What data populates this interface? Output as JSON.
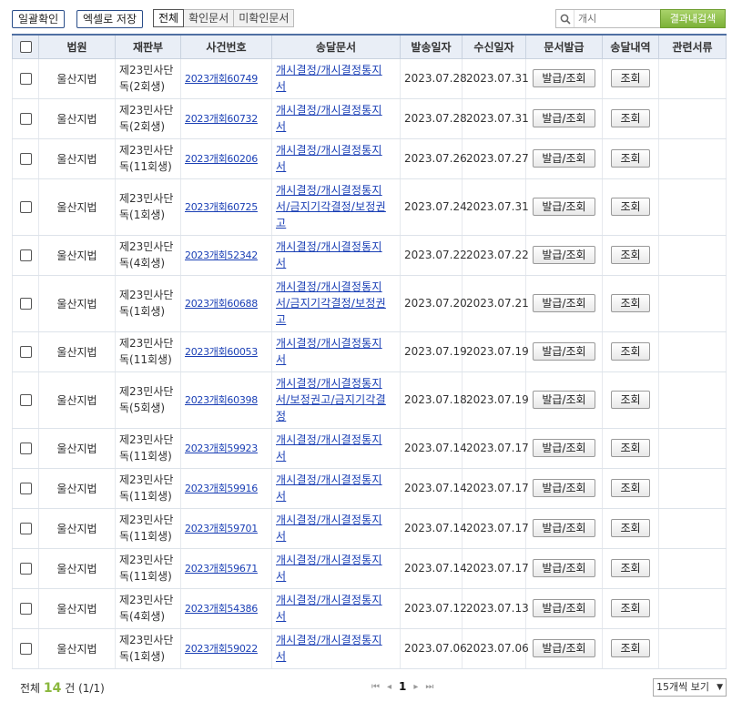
{
  "toolbar": {
    "bulk_confirm_label": "일괄확인",
    "excel_save_label": "엑셀로 저장",
    "tabs": [
      "전체",
      "확인문서",
      "미확인문서"
    ],
    "search_placeholder": "개시",
    "search_button_label": "결과내검색"
  },
  "table": {
    "headers": [
      "법원",
      "재판부",
      "사건번호",
      "송달문서",
      "발송일자",
      "수신일자",
      "문서발급",
      "송달내역",
      "관련서류"
    ],
    "issue_button_label": "발급/조회",
    "view_button_label": "조회",
    "rows": [
      {
        "court": "울산지법",
        "division_1": "제23민사단",
        "division_2": "독(2회생)",
        "case_no": "2023개회60749",
        "doc_lines": [
          "개시결정/개시결정통지",
          "서"
        ],
        "sent": "2023.07.28",
        "received": "2023.07.31"
      },
      {
        "court": "울산지법",
        "division_1": "제23민사단",
        "division_2": "독(2회생)",
        "case_no": "2023개회60732",
        "doc_lines": [
          "개시결정/개시결정통지",
          "서"
        ],
        "sent": "2023.07.28",
        "received": "2023.07.31"
      },
      {
        "court": "울산지법",
        "division_1": "제23민사단",
        "division_2": "독(11회생)",
        "case_no": "2023개회60206",
        "doc_lines": [
          "개시결정/개시결정통지",
          "서"
        ],
        "sent": "2023.07.26",
        "received": "2023.07.27"
      },
      {
        "court": "울산지법",
        "division_1": "제23민사단",
        "division_2": "독(1회생)",
        "case_no": "2023개회60725",
        "doc_lines": [
          "개시결정/개시결정통지",
          "서/금지기각결정/보정권",
          "고"
        ],
        "sent": "2023.07.24",
        "received": "2023.07.31"
      },
      {
        "court": "울산지법",
        "division_1": "제23민사단",
        "division_2": "독(4회생)",
        "case_no": "2023개회52342",
        "doc_lines": [
          "개시결정/개시결정통지",
          "서"
        ],
        "sent": "2023.07.22",
        "received": "2023.07.22"
      },
      {
        "court": "울산지법",
        "division_1": "제23민사단",
        "division_2": "독(1회생)",
        "case_no": "2023개회60688",
        "doc_lines": [
          "개시결정/개시결정통지",
          "서/금지기각결정/보정권",
          "고"
        ],
        "sent": "2023.07.20",
        "received": "2023.07.21"
      },
      {
        "court": "울산지법",
        "division_1": "제23민사단",
        "division_2": "독(11회생)",
        "case_no": "2023개회60053",
        "doc_lines": [
          "개시결정/개시결정통지",
          "서"
        ],
        "sent": "2023.07.19",
        "received": "2023.07.19"
      },
      {
        "court": "울산지법",
        "division_1": "제23민사단",
        "division_2": "독(5회생)",
        "case_no": "2023개회60398",
        "doc_lines": [
          "개시결정/개시결정통지",
          "서/보정권고/금지기각결",
          "정"
        ],
        "sent": "2023.07.18",
        "received": "2023.07.19"
      },
      {
        "court": "울산지법",
        "division_1": "제23민사단",
        "division_2": "독(11회생)",
        "case_no": "2023개회59923",
        "doc_lines": [
          "개시결정/개시결정통지",
          "서"
        ],
        "sent": "2023.07.14",
        "received": "2023.07.17"
      },
      {
        "court": "울산지법",
        "division_1": "제23민사단",
        "division_2": "독(11회생)",
        "case_no": "2023개회59916",
        "doc_lines": [
          "개시결정/개시결정통지",
          "서"
        ],
        "sent": "2023.07.14",
        "received": "2023.07.17"
      },
      {
        "court": "울산지법",
        "division_1": "제23민사단",
        "division_2": "독(11회생)",
        "case_no": "2023개회59701",
        "doc_lines": [
          "개시결정/개시결정통지",
          "서"
        ],
        "sent": "2023.07.14",
        "received": "2023.07.17"
      },
      {
        "court": "울산지법",
        "division_1": "제23민사단",
        "division_2": "독(11회생)",
        "case_no": "2023개회59671",
        "doc_lines": [
          "개시결정/개시결정통지",
          "서"
        ],
        "sent": "2023.07.14",
        "received": "2023.07.17"
      },
      {
        "court": "울산지법",
        "division_1": "제23민사단",
        "division_2": "독(4회생)",
        "case_no": "2023개회54386",
        "doc_lines": [
          "개시결정/개시결정통지",
          "서"
        ],
        "sent": "2023.07.12",
        "received": "2023.07.13"
      },
      {
        "court": "울산지법",
        "division_1": "제23민사단",
        "division_2": "독(1회생)",
        "case_no": "2023개회59022",
        "doc_lines": [
          "개시결정/개시결정통지",
          "서"
        ],
        "sent": "2023.07.06",
        "received": "2023.07.06"
      }
    ]
  },
  "footer": {
    "total_prefix": "전체",
    "total_count": "14",
    "total_suffix": "건",
    "page_info": "(1/1)",
    "current_page": "1",
    "per_page": "15개씩 보기"
  },
  "colors": {
    "accent_green": "#8ab73d",
    "link_blue": "#1a3fb5",
    "header_border": "#4f6fa3"
  }
}
